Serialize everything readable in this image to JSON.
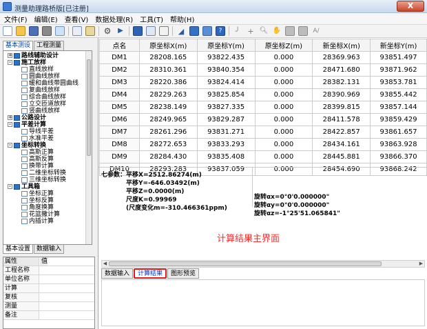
{
  "window": {
    "title": "测量助理路桥版[已注册]",
    "close": "X"
  },
  "menu": [
    "文件(F)",
    "编辑(E)",
    "查看(V)",
    "数据处理(R)",
    "工具(T)",
    "帮助(H)"
  ],
  "toolbar": {
    "label_glyph": "A/",
    "hand_glyph": "✋"
  },
  "left_tabs": [
    "基本测设",
    "工程测量"
  ],
  "tree": [
    {
      "label": "路线辅助设计",
      "level": 0,
      "type": "group",
      "expander": "+"
    },
    {
      "label": "施工放样",
      "level": 0,
      "type": "group",
      "expander": "-"
    },
    {
      "label": "直线放样",
      "level": 1,
      "type": "leaf"
    },
    {
      "label": "圆曲线放样",
      "level": 1,
      "type": "leaf"
    },
    {
      "label": "缓和曲线带圆曲线",
      "level": 1,
      "type": "leaf"
    },
    {
      "label": "复曲线放样",
      "level": 1,
      "type": "leaf"
    },
    {
      "label": "综合曲线放样",
      "level": 1,
      "type": "leaf"
    },
    {
      "label": "立交匝道放样",
      "level": 1,
      "type": "leaf"
    },
    {
      "label": "竖曲线放样",
      "level": 1,
      "type": "leaf"
    },
    {
      "label": "公路设计",
      "level": 0,
      "type": "group",
      "expander": "+"
    },
    {
      "label": "平差计算",
      "level": 0,
      "type": "group",
      "expander": "-"
    },
    {
      "label": "导线平差",
      "level": 1,
      "type": "leaf"
    },
    {
      "label": "水准平差",
      "level": 1,
      "type": "leaf"
    },
    {
      "label": "坐标转换",
      "level": 0,
      "type": "group",
      "expander": "-"
    },
    {
      "label": "高斯正算",
      "level": 1,
      "type": "leaf"
    },
    {
      "label": "高斯反算",
      "level": 1,
      "type": "leaf"
    },
    {
      "label": "换带计算",
      "level": 1,
      "type": "leaf"
    },
    {
      "label": "二维坐标转换",
      "level": 1,
      "type": "leaf"
    },
    {
      "label": "三维坐标转换",
      "level": 1,
      "type": "leaf"
    },
    {
      "label": "工具箱",
      "level": 0,
      "type": "group",
      "expander": "-"
    },
    {
      "label": "坐标正算",
      "level": 1,
      "type": "leaf"
    },
    {
      "label": "坐标反算",
      "level": 1,
      "type": "leaf"
    },
    {
      "label": "角度换算",
      "level": 1,
      "type": "leaf"
    },
    {
      "label": "花篮撒计算",
      "level": 1,
      "type": "leaf"
    },
    {
      "label": "内插计算",
      "level": 1,
      "type": "leaf"
    }
  ],
  "bottom_tabs": [
    "基本设置",
    "数据输入"
  ],
  "props": {
    "header": {
      "k": "属性",
      "v": "值"
    },
    "rows": [
      "工程名称",
      "单位名称",
      "计算",
      "复核",
      "测量",
      "备注"
    ]
  },
  "table": {
    "headers": [
      "点名",
      "原坐标X(m)",
      "原坐标Y(m)",
      "原坐标Z(m)",
      "新坐标X(m)",
      "新坐标Y(m)"
    ],
    "rows": [
      [
        "DM1",
        "28208.165",
        "93822.435",
        "0.000",
        "28369.963",
        "93851.497"
      ],
      [
        "DM2",
        "28310.361",
        "93840.354",
        "0.000",
        "28471.680",
        "93871.962"
      ],
      [
        "DM3",
        "28220.386",
        "93824.414",
        "0.000",
        "28382.131",
        "93853.781"
      ],
      [
        "DM4",
        "28229.263",
        "93825.854",
        "0.000",
        "28390.969",
        "93855.442"
      ],
      [
        "DM5",
        "28238.149",
        "93827.335",
        "0.000",
        "28399.815",
        "93857.144"
      ],
      [
        "DM6",
        "28249.965",
        "93829.287",
        "0.000",
        "28411.578",
        "93859.429"
      ],
      [
        "DM7",
        "28261.296",
        "93831.271",
        "0.000",
        "28422.857",
        "93861.657"
      ],
      [
        "DM8",
        "28272.653",
        "93833.293",
        "0.000",
        "28434.161",
        "93863.928"
      ],
      [
        "DM9",
        "28284.430",
        "93835.408",
        "0.000",
        "28445.881",
        "93866.370"
      ],
      [
        "DM10",
        "28293.283",
        "93837.059",
        "0.000",
        "28454.690",
        "93868.242"
      ]
    ]
  },
  "params": {
    "label": "七参数：",
    "lines": [
      "平移X=2512.86274(m)",
      "平移Y=-646.03492(m)",
      "平移Z=0.0000(m)",
      "尺度K=0.99969",
      "(尺度变化m=-310.466361ppm)"
    ],
    "rotations": [
      "旋转αx=0°0'0.000000\"",
      "旋转αy=0°0'0.000000\"",
      "旋转αz=-1°25'51.065841\""
    ]
  },
  "caption": "计算结果主界面",
  "output_tabs": [
    "数据输入",
    "计算结果",
    "图形预览"
  ]
}
